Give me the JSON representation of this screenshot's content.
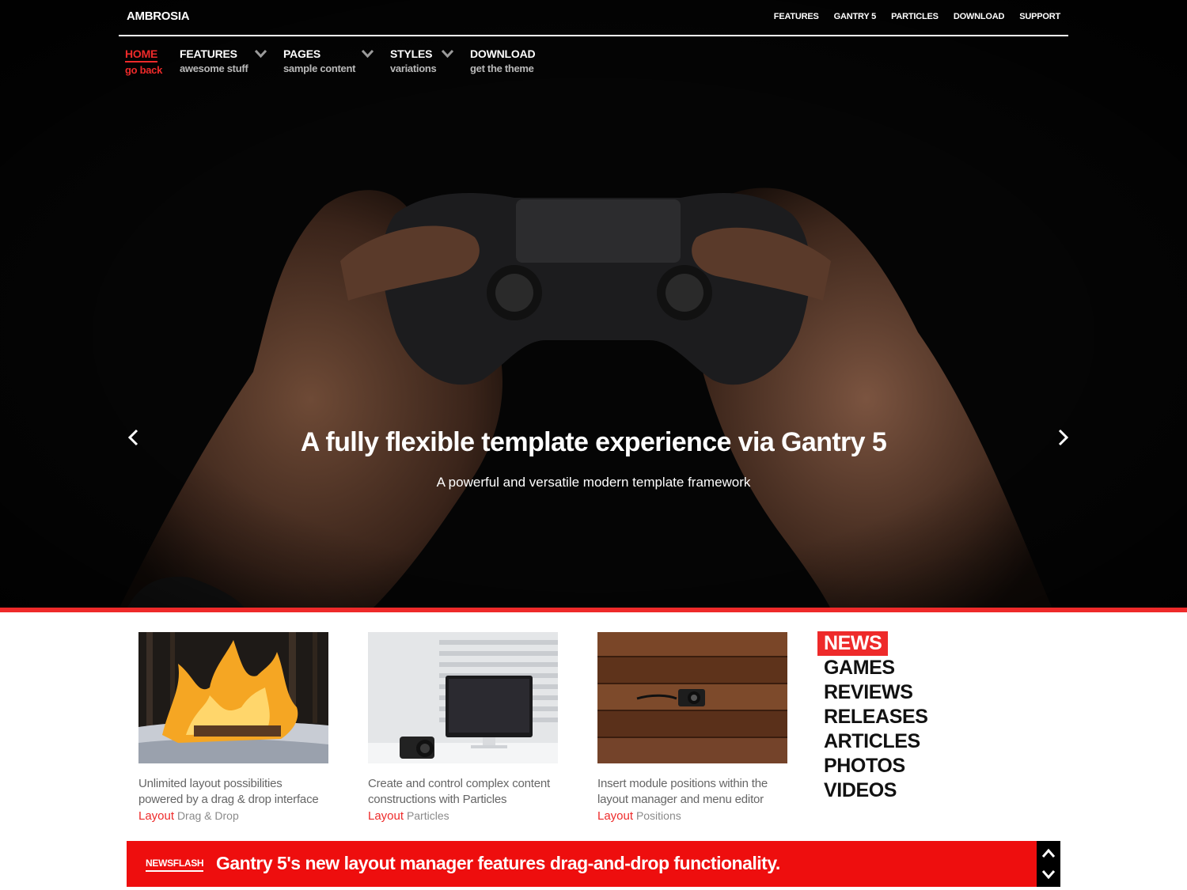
{
  "topbar": {
    "logo": "AMBROSIA",
    "links": [
      "FEATURES",
      "GANTRY 5",
      "PARTICLES",
      "DOWNLOAD",
      "SUPPORT"
    ]
  },
  "menu": [
    {
      "title": "HOME",
      "sub": "go back",
      "active": true
    },
    {
      "title": "FEATURES",
      "sub": "awesome stuff"
    },
    {
      "title": "PAGES",
      "sub": "sample content"
    },
    {
      "title": "STYLES",
      "sub": "variations"
    },
    {
      "title": "DOWNLOAD",
      "sub": "get the theme"
    }
  ],
  "slider": {
    "title": "A fully flexible template experience via Gantry 5",
    "subtitle": "A powerful and versatile modern template framework"
  },
  "cards": [
    {
      "text": "Unlimited layout possibilities powered by a drag & drop interface",
      "category": "Layout",
      "tag": "Drag & Drop"
    },
    {
      "text": "Create and control complex content constructions with Particles",
      "category": "Layout",
      "tag": "Particles"
    },
    {
      "text": "Insert module positions within the layout manager and menu editor",
      "category": "Layout",
      "tag": "Positions"
    }
  ],
  "categories": [
    "NEWS",
    "GAMES",
    "REVIEWS",
    "RELEASES",
    "ARTICLES",
    "PHOTOS",
    "VIDEOS"
  ],
  "newsflash": {
    "label": "NEWSFLASH",
    "text": "Gantry 5's new layout manager features drag-and-drop functionality."
  },
  "colors": {
    "accent": "#ee2a2a",
    "newsflash_bg": "#ee0e0e"
  }
}
